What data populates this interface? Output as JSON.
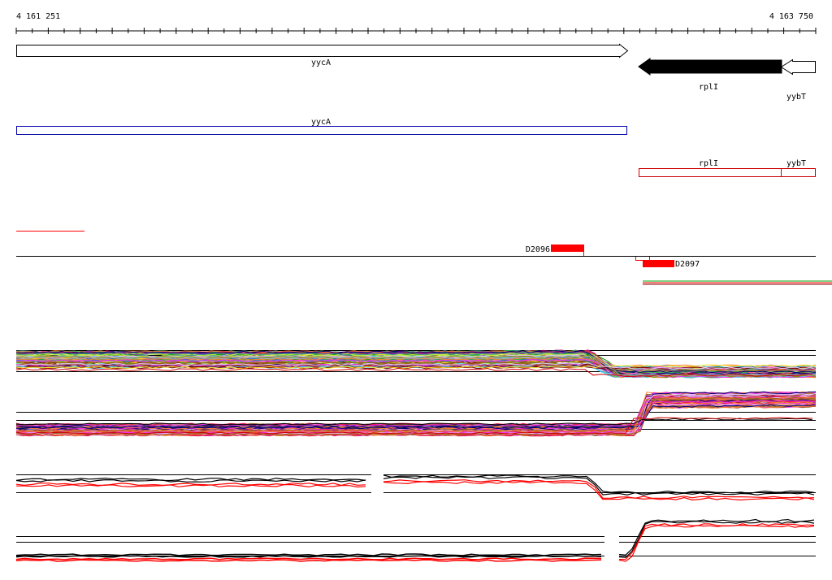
{
  "axis": {
    "start_label": "4 161 251",
    "end_label": "4 163 750",
    "start": 4161251,
    "end": 4163750
  },
  "genes": [
    {
      "name": "yycA",
      "strand": "+",
      "fill": "#ffffff"
    },
    {
      "name": "rplI",
      "strand": "-",
      "fill": "#000000"
    },
    {
      "name": "yybT",
      "strand": "-",
      "fill": "#ffffff"
    }
  ],
  "transcript_blue": {
    "label": "yycA",
    "color": "#0000aa"
  },
  "transcripts_red": [
    {
      "label": "rplI",
      "color": "#cc0000"
    },
    {
      "label": "yybT",
      "color": "#cc0000"
    }
  ],
  "probes": [
    {
      "label": "D2096",
      "color": "#ff0000"
    },
    {
      "label": "D2097",
      "color": "#ff0000"
    }
  ],
  "colors": {
    "accent_red": "#ff0000",
    "dark_red": "#cc0000",
    "blue": "#0000aa",
    "black": "#000000"
  },
  "profile_palette": [
    "#e6194b",
    "#3cb44b",
    "#4363d8",
    "#f58231",
    "#911eb4",
    "#42d4f4",
    "#f032e6",
    "#bfef45",
    "#469990",
    "#9a6324",
    "#800000",
    "#808000",
    "#000075",
    "#a9a9a9",
    "#ffe119",
    "#e6beff",
    "#00a000",
    "#ff69b4"
  ]
}
